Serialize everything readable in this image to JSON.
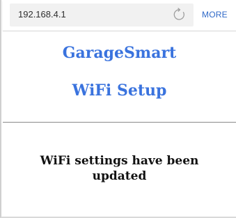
{
  "browser": {
    "url": "192.168.4.1",
    "reload_icon": "reload-icon",
    "more_label": "MORE",
    "accent_color": "#2f69c8"
  },
  "page": {
    "title": "GarageSmart",
    "subtitle": "WiFi Setup",
    "heading_color": "#3a73de",
    "message": "WiFi settings have been updated"
  }
}
